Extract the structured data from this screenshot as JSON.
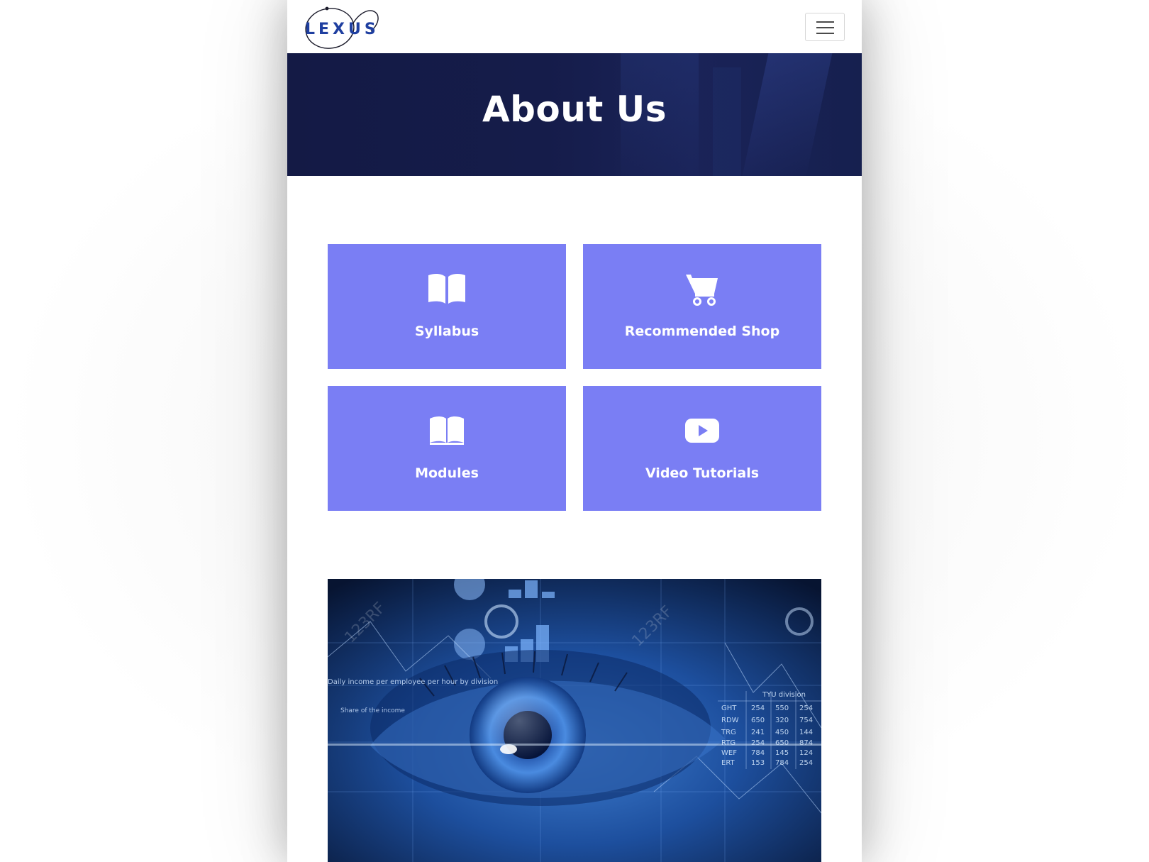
{
  "brand": {
    "logo_text": "LEXUS",
    "logo_color": "#1f3fa0"
  },
  "navbar": {
    "toggler_icon": "hamburger-icon"
  },
  "hero": {
    "title": "About Us",
    "background_color": "#151c4a"
  },
  "tiles": [
    {
      "label": "Syllabus",
      "icon": "open-book-icon"
    },
    {
      "label": "Recommended Shop",
      "icon": "shopping-cart-icon"
    },
    {
      "label": "Modules",
      "icon": "book-icon"
    },
    {
      "label": "Video Tutorials",
      "icon": "youtube-play-icon"
    }
  ],
  "tile_color": "#7a7ef4",
  "feature_image": {
    "subject": "digital-eye-image",
    "table_header": "TYU division",
    "table_rows": [
      [
        "GHT",
        "254",
        "550",
        "254"
      ],
      [
        "RDW",
        "650",
        "320",
        "754"
      ],
      [
        "TRG",
        "241",
        "450",
        "144"
      ],
      [
        "RTG",
        "254",
        "650",
        "874"
      ],
      [
        "WEF",
        "784",
        "145",
        "124"
      ],
      [
        "ERT",
        "153",
        "784",
        "254"
      ]
    ],
    "caption_1": "Daily income per employee per hour by division",
    "caption_2": "Share of the income",
    "watermark": "123RF"
  }
}
